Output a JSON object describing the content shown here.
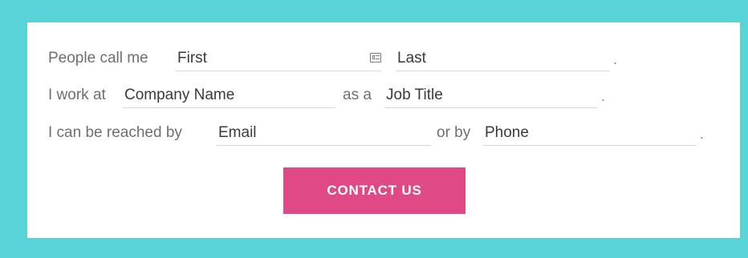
{
  "form": {
    "row1": {
      "prefix": "People call me",
      "first_placeholder": "First",
      "last_placeholder": "Last",
      "suffix": "."
    },
    "row2": {
      "prefix": "I work at",
      "company_placeholder": "Company Name",
      "middle": "as a",
      "job_placeholder": "Job Title",
      "suffix": "."
    },
    "row3": {
      "prefix": "I can be reached by",
      "email_placeholder": "Email",
      "middle": "or by",
      "phone_placeholder": "Phone",
      "suffix": "."
    },
    "button_label": "CONTACT US"
  },
  "colors": {
    "background": "#5ad3d6",
    "card": "#ffffff",
    "button": "#df4a86",
    "label_text": "#6f6f6f",
    "field_text": "#3a3a3a",
    "field_line": "#d8d8d8"
  },
  "icons": {
    "contact_card": "contact-card-icon"
  }
}
